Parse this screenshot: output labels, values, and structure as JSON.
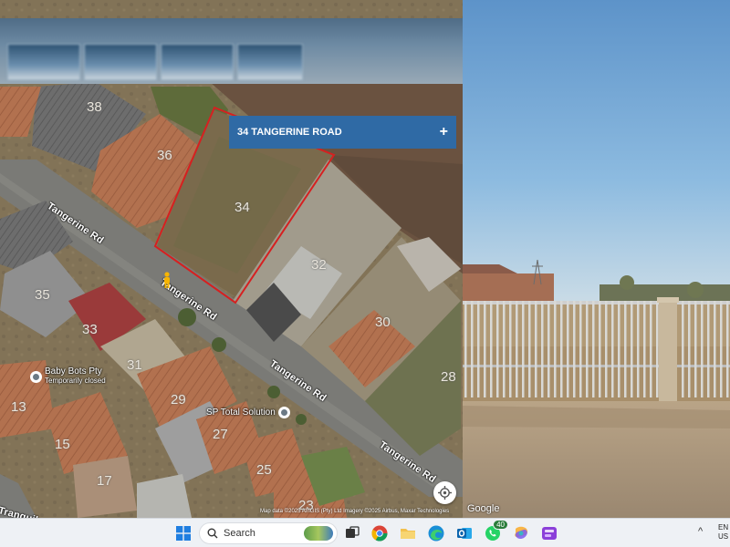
{
  "map": {
    "address_card": {
      "title": "34 TANGERINE ROAD",
      "action": "+"
    },
    "lot_numbers": [
      "38",
      "36",
      "34",
      "35",
      "32",
      "33",
      "30",
      "31",
      "13",
      "29",
      "28",
      "15",
      "27",
      "17",
      "25",
      "23"
    ],
    "road_labels": [
      "Tangerine Rd",
      "Tangerine Rd",
      "Tangerine Rd",
      "Tangerine Rd",
      "Tranquil"
    ],
    "poi": [
      {
        "label": "Baby Bots Pty",
        "sublabel": "Temporarily closed"
      },
      {
        "label": "SP Total Solution"
      }
    ],
    "attribution": "Map data ©2025 AfriGIS (Pty) Ltd Imagery ©2025 Airbus, Maxar Technologies",
    "parcel_color": "#d62020",
    "card_color": "#2f6aa5"
  },
  "street_view": {
    "logo": "Google"
  },
  "taskbar": {
    "search_placeholder": "Search",
    "whatsapp_badge": "40",
    "tray_lang_line1": "EN",
    "tray_lang_line2": "US",
    "tray_chevron": "^",
    "icons": [
      "windows-start-icon",
      "search-icon",
      "task-view-icon",
      "chrome-icon",
      "file-explorer-icon",
      "edge-icon",
      "outlook-icon",
      "whatsapp-icon",
      "copilot-icon",
      "clipchamp-icon"
    ]
  }
}
